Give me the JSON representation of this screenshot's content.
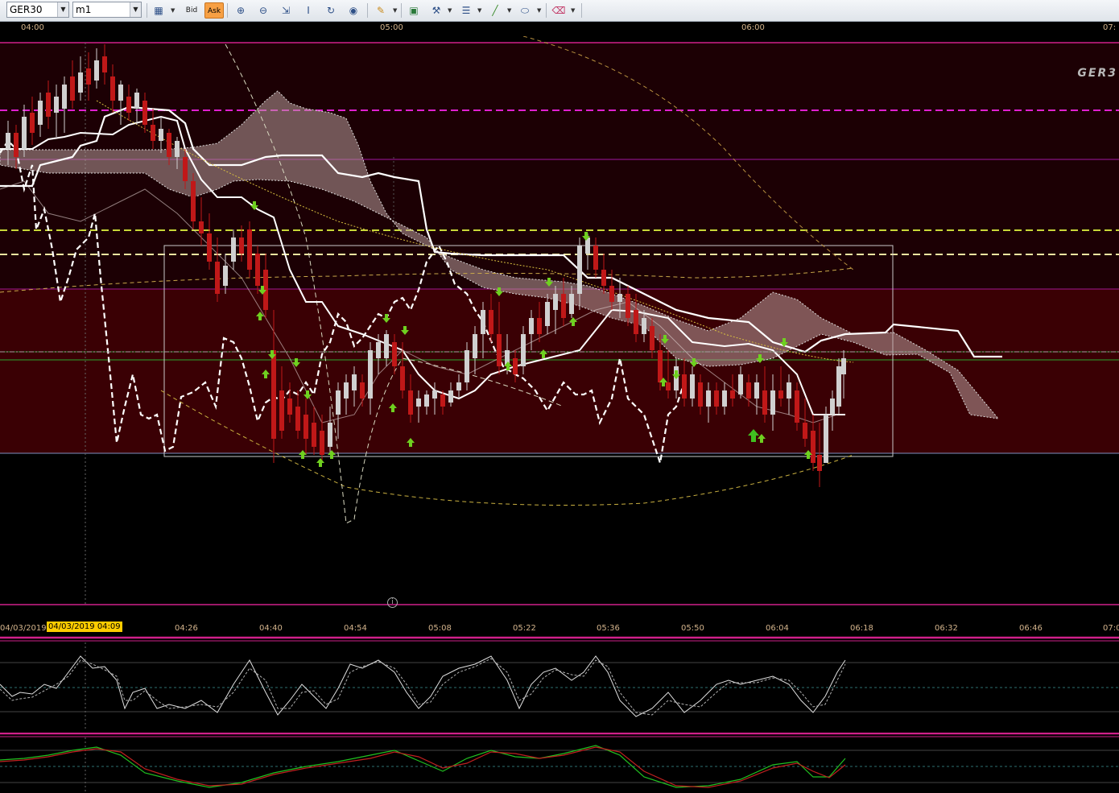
{
  "toolbar": {
    "symbol": "GER30",
    "timeframe": "m1",
    "bid_label": "Bid",
    "ask_label": "Ask",
    "icons": [
      "chart-type-icon",
      "bid-ask-icon",
      "zoom-in-icon",
      "zoom-out-icon",
      "fit-icon",
      "indicator-icon",
      "refresh-icon",
      "globe-icon",
      "pencil-icon",
      "image-icon",
      "tools-icon",
      "lines-icon",
      "trendline-icon",
      "shape-icon",
      "eraser-icon"
    ]
  },
  "top_axis": {
    "ticks": [
      "04:00",
      "05:00",
      "06:00",
      "07:"
    ]
  },
  "main_chart": {
    "watermark": "GER3",
    "info_glyph": "i",
    "colors": {
      "background_upper": "#1a0004",
      "background_zone": "#3a0003",
      "magenta_line": "#e020d0",
      "yellow_line": "#d8e040",
      "cream_line": "#f0e6a0",
      "candle_up": "#d0d0d0",
      "candle_down": "#c01818",
      "arrow": "#6fd020"
    }
  },
  "bottom_axis": {
    "cursor_label": "04/03/2019 04:09",
    "date_prefix": "04/03/2019",
    "ticks": [
      "04:26",
      "04:40",
      "04:54",
      "05:08",
      "05:22",
      "05:36",
      "05:50",
      "06:04",
      "06:18",
      "06:32",
      "06:46",
      "07:0"
    ]
  }
}
